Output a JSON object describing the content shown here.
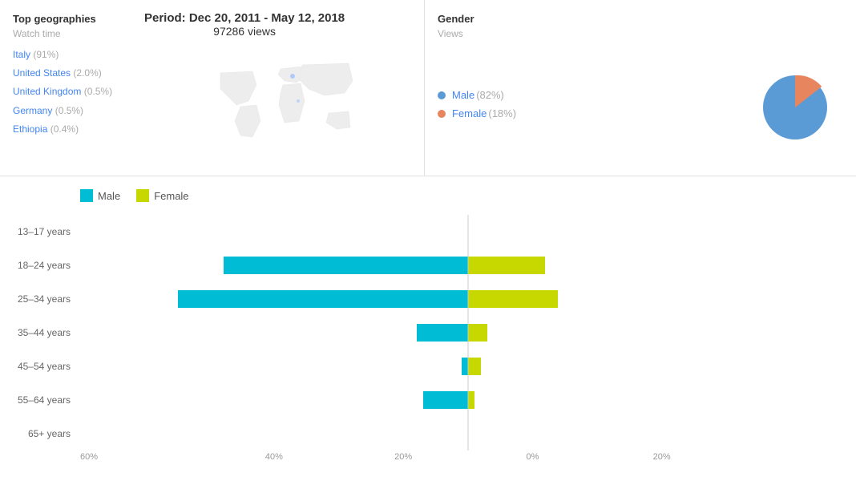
{
  "top_geo": {
    "title": "Top geographies",
    "subtitle": "Watch time",
    "period": "Period: Dec 20, 2011 - May 12, 2018",
    "views": "97286 views",
    "countries": [
      {
        "name": "Italy",
        "pct": "(91%)"
      },
      {
        "name": "United States",
        "pct": "(2.0%)"
      },
      {
        "name": "United Kingdom",
        "pct": "(0.5%)"
      },
      {
        "name": "Germany",
        "pct": "(0.5%)"
      },
      {
        "name": "Ethiopia",
        "pct": "(0.4%)"
      }
    ]
  },
  "gender": {
    "title": "Gender",
    "subtitle": "Views",
    "items": [
      {
        "label": "Male",
        "pct": "(82%)",
        "color": "#5b9bd5"
      },
      {
        "label": "Female",
        "pct": "(18%)",
        "color": "#e6855e"
      }
    ],
    "pie": {
      "male_pct": 82,
      "female_pct": 18,
      "male_color": "#5b9bd5",
      "female_color": "#e6855e"
    }
  },
  "bar_chart": {
    "legend": [
      {
        "label": "Male",
        "color": "#00bcd4"
      },
      {
        "label": "Female",
        "color": "#c6d800"
      }
    ],
    "age_groups": [
      {
        "label": "13–17 years",
        "male": 0,
        "female": 0
      },
      {
        "label": "18–24 years",
        "male": 38,
        "female": 12
      },
      {
        "label": "25–34 years",
        "male": 45,
        "female": 14
      },
      {
        "label": "35–44 years",
        "male": 8,
        "female": 3
      },
      {
        "label": "45–54 years",
        "male": 1,
        "female": 2
      },
      {
        "label": "55–64 years",
        "male": 7,
        "female": 1
      },
      {
        "label": "65+ years",
        "male": 0,
        "female": 0
      }
    ],
    "x_labels": [
      "60%",
      "40%",
      "20%",
      "0%",
      "20%"
    ]
  }
}
